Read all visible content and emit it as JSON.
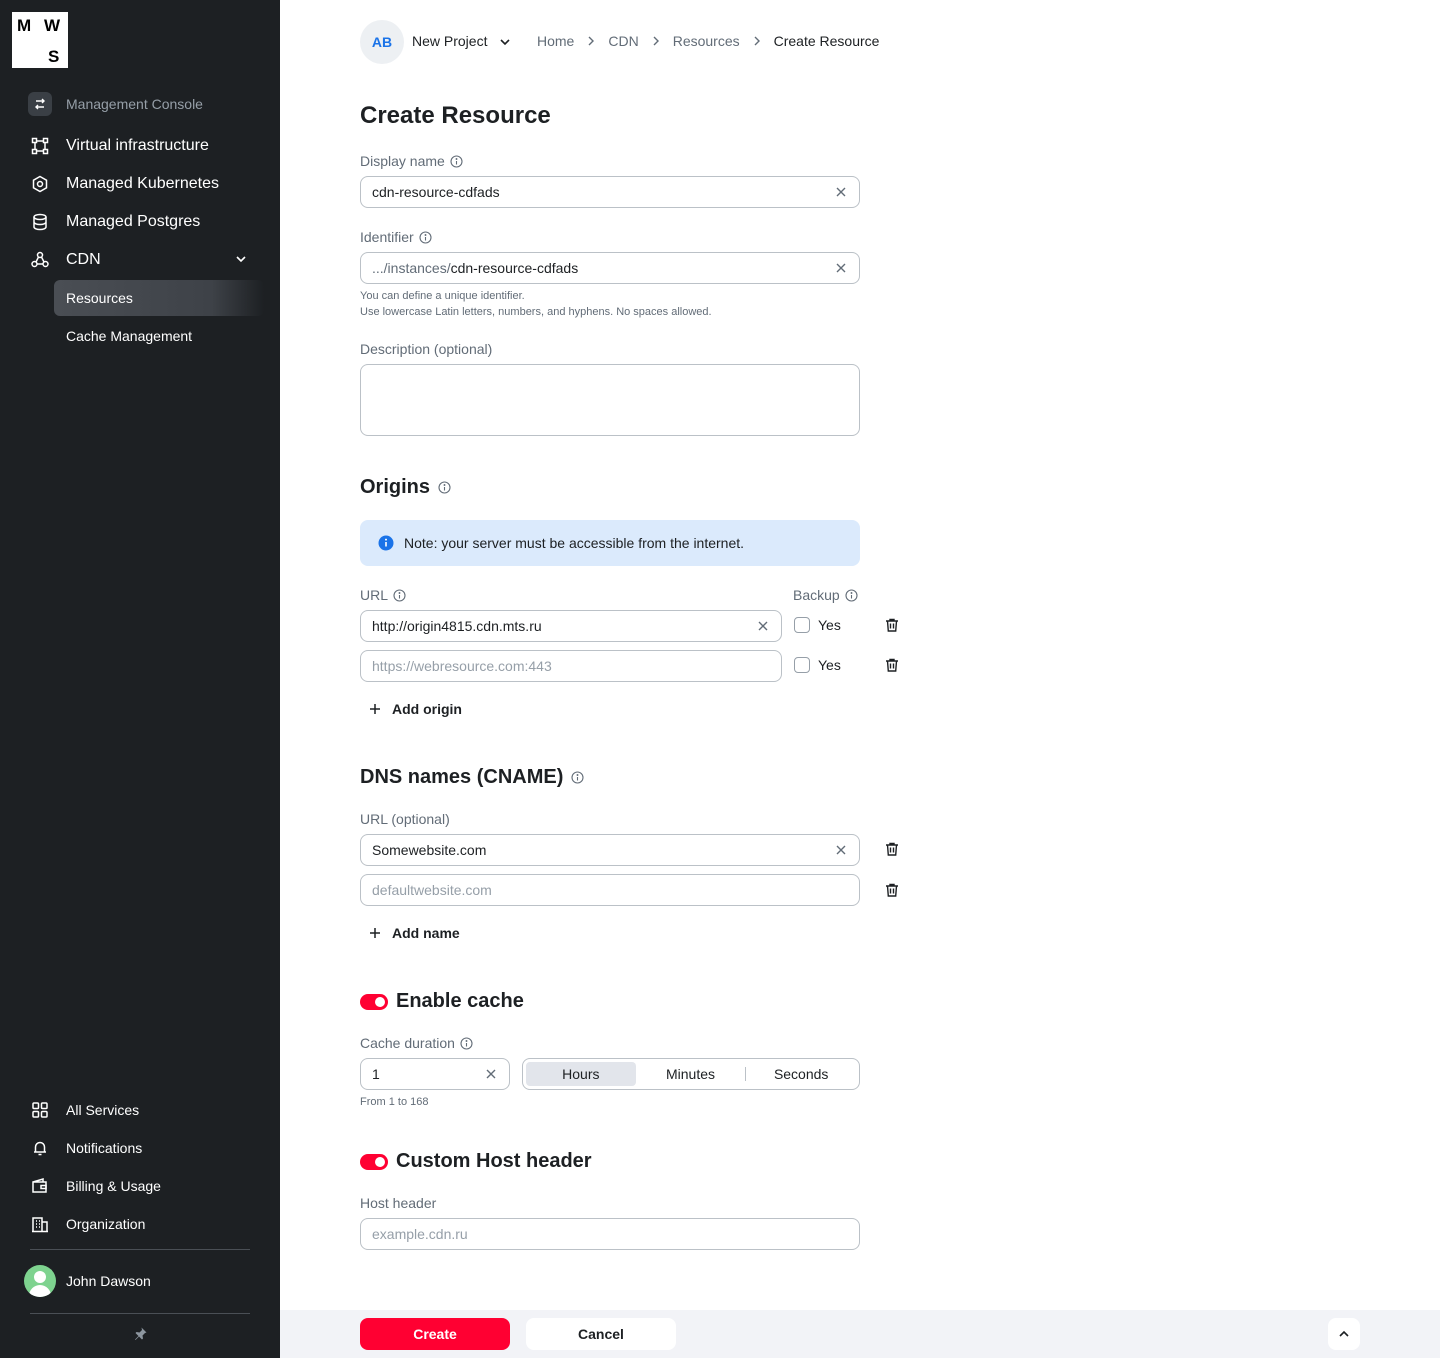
{
  "logo": {
    "l1": "M",
    "l2": "W",
    "l3": "S"
  },
  "sidebar": {
    "console_label": "Management Console",
    "items": [
      {
        "label": "Virtual infrastructure",
        "icon": "vm-icon"
      },
      {
        "label": "Managed Kubernetes",
        "icon": "kubernetes-icon"
      },
      {
        "label": "Managed Postgres",
        "icon": "database-icon"
      },
      {
        "label": "CDN",
        "icon": "cdn-icon"
      }
    ],
    "cdn_sub": [
      {
        "label": "Resources",
        "active": true
      },
      {
        "label": "Cache Management",
        "active": false
      }
    ],
    "bottom": [
      {
        "label": "All Services",
        "icon": "grid-icon"
      },
      {
        "label": "Notifications",
        "icon": "bell-icon"
      },
      {
        "label": "Billing & Usage",
        "icon": "wallet-icon"
      },
      {
        "label": "Organization",
        "icon": "building-icon"
      }
    ],
    "user": "John Dawson"
  },
  "topbar": {
    "avatar": "AB",
    "project": "New Project",
    "breadcrumb": [
      "Home",
      "CDN",
      "Resources",
      "Create Resource"
    ]
  },
  "form": {
    "title": "Create Resource",
    "display_name": {
      "label": "Display name",
      "value": "cdn-resource-cdfads"
    },
    "identifier": {
      "label": "Identifier",
      "prefix": ".../instances/",
      "value": "cdn-resource-cdfads",
      "help1": "You can define a unique identifier.",
      "help2": "Use lowercase Latin letters, numbers, and hyphens. No spaces allowed."
    },
    "description": {
      "label": "Description (optional)",
      "value": ""
    },
    "origins": {
      "title": "Origins",
      "note": "Note: your server must be accessible from the internet.",
      "url_label": "URL",
      "backup_label": "Backup",
      "rows": [
        {
          "value": "http://origin4815.cdn.mts.ru",
          "placeholder": "",
          "backup_label": "Yes",
          "backup": false
        },
        {
          "value": "",
          "placeholder": "https://webresource.com:443",
          "backup_label": "Yes",
          "backup": false
        }
      ],
      "add_label": "Add origin"
    },
    "dns": {
      "title": "DNS names (CNAME)",
      "url_label": "URL (optional)",
      "rows": [
        {
          "value": "Somewebsite.com",
          "placeholder": ""
        },
        {
          "value": "",
          "placeholder": "defaultwebsite.com"
        }
      ],
      "add_label": "Add name"
    },
    "cache": {
      "title": "Enable cache",
      "enabled": true,
      "duration_label": "Cache duration",
      "value": "1",
      "units": [
        "Hours",
        "Minutes",
        "Seconds"
      ],
      "selected_unit": "Hours",
      "help": "From 1 to 168"
    },
    "host": {
      "title": "Custom Host header",
      "enabled": true,
      "label": "Host header",
      "placeholder": "example.cdn.ru"
    }
  },
  "footer": {
    "create": "Create",
    "cancel": "Cancel"
  },
  "colors": {
    "accent": "#ff0032",
    "sidebar_bg": "#1d2023",
    "info_bg": "#dbeafc",
    "info_icon": "#1a73e8"
  }
}
